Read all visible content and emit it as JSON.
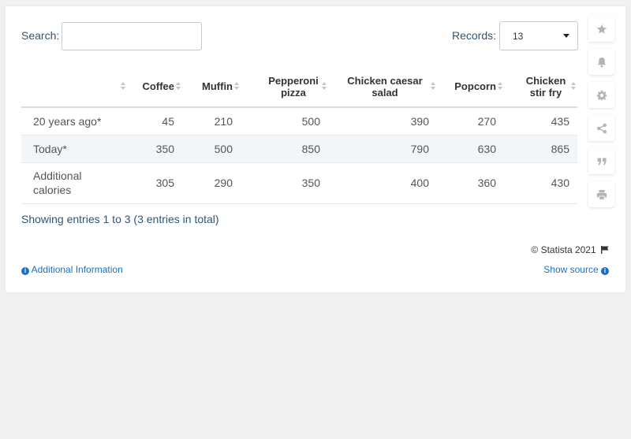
{
  "search": {
    "label": "Search:",
    "value": "",
    "placeholder": ""
  },
  "records": {
    "label": "Records:",
    "value": "13"
  },
  "table": {
    "headers": [
      "",
      "Coffee",
      "Muffin",
      "Pepperoni pizza",
      "Chicken caesar salad",
      "Popcorn",
      "Chicken stir fry"
    ],
    "rows": [
      [
        "20 years ago*",
        "45",
        "210",
        "500",
        "390",
        "270",
        "435"
      ],
      [
        "Today*",
        "350",
        "500",
        "850",
        "790",
        "630",
        "865"
      ],
      [
        "Additional calories",
        "305",
        "290",
        "350",
        "400",
        "360",
        "430"
      ]
    ]
  },
  "footer": {
    "entries_info": "Showing entries 1 to 3 (3 entries in total)",
    "copyright": "© Statista 2021",
    "additional_info": "Additional Information",
    "show_source": "Show source"
  },
  "sidebar_icons": [
    "star-icon",
    "bell-icon",
    "gear-icon",
    "share-icon",
    "quote-icon",
    "print-icon"
  ]
}
